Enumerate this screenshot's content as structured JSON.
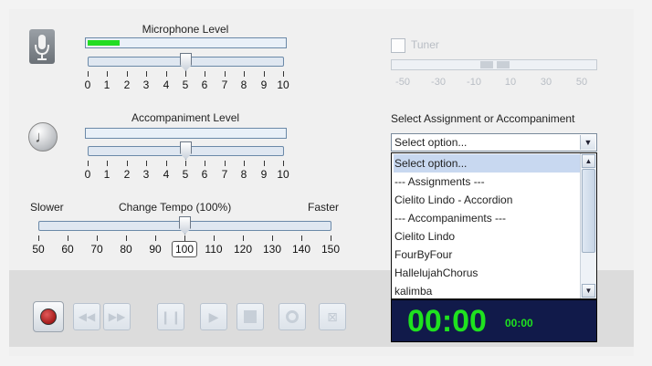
{
  "microphone": {
    "title": "Microphone Level",
    "level": 0.16,
    "slider_value": 5,
    "scale": [
      "0",
      "1",
      "2",
      "3",
      "4",
      "5",
      "6",
      "7",
      "8",
      "9",
      "10"
    ]
  },
  "accompaniment": {
    "title": "Accompaniment Level",
    "level": 0,
    "slider_value": 5,
    "scale": [
      "0",
      "1",
      "2",
      "3",
      "4",
      "5",
      "6",
      "7",
      "8",
      "9",
      "10"
    ]
  },
  "tempo": {
    "title": "Change Tempo (100%)",
    "slower_label": "Slower",
    "faster_label": "Faster",
    "value": 100,
    "scale": [
      "50",
      "60",
      "70",
      "80",
      "90",
      "100",
      "110",
      "120",
      "130",
      "140",
      "150"
    ]
  },
  "tuner": {
    "label": "Tuner",
    "checked": false,
    "scale": [
      "-50",
      "-30",
      "-10",
      "10",
      "30",
      "50"
    ]
  },
  "select": {
    "title": "Select Assignment or Accompaniment",
    "value": "Select option...",
    "options": [
      "Select option...",
      "--- Assignments ---",
      "Cielito Lindo - Accordion",
      "--- Accompaniments ---",
      "Cielito Lindo",
      "FourByFour",
      "HallelujahChorus",
      "kalimba"
    ],
    "highlighted_index": 0
  },
  "timer": {
    "main": "00:00",
    "sub": "00:00"
  },
  "controls": {
    "record": "record-icon",
    "buttons": [
      "rewind-icon",
      "fast-forward-icon",
      "pause-icon",
      "play-icon",
      "stop-icon",
      "loop-icon",
      "close-box-icon"
    ]
  },
  "colors": {
    "level_fill": "#22dd22",
    "timer_bg": "#111a4a",
    "timer_text": "#1fe21f",
    "record": "#8b0000"
  }
}
